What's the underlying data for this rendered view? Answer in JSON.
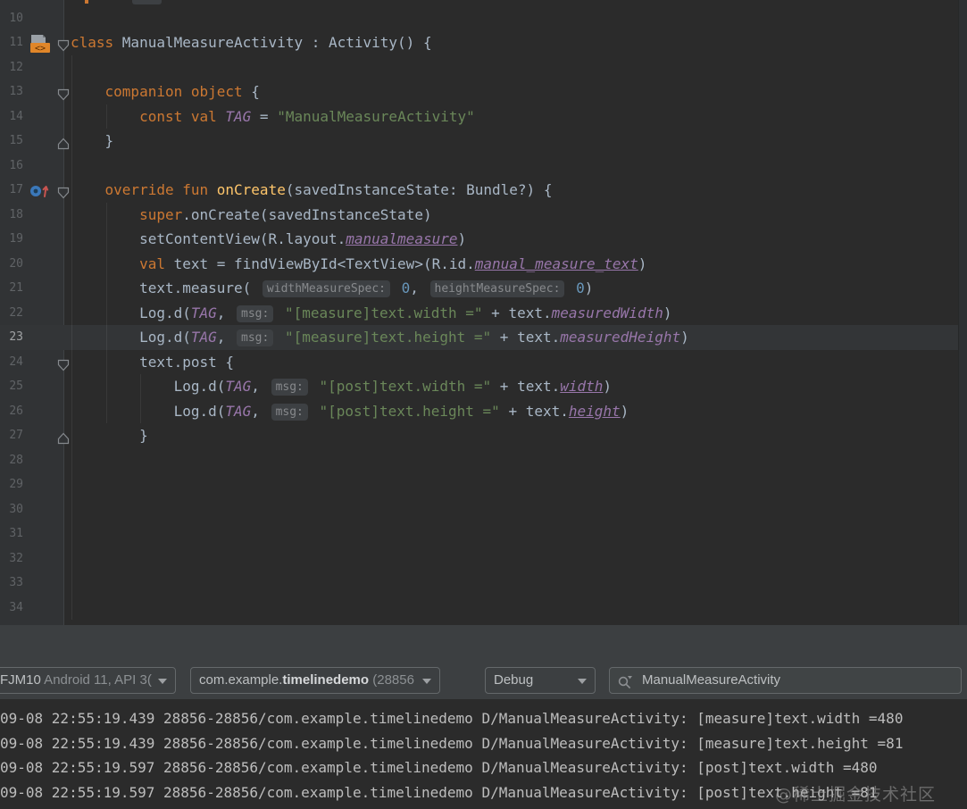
{
  "colors": {
    "editor_bg": "#2b2b2b",
    "gutter_bg": "#313335",
    "active_line_bg": "#333537",
    "keyword": "#cc7832",
    "string": "#6a8759",
    "number": "#6897bb",
    "property": "#9876aa",
    "function_decl": "#ffc66b",
    "default_text": "#a9b7c6",
    "line_number": "#606366",
    "hint_bg": "#3d4043",
    "hint_text": "#87898c",
    "toolbar_bg": "#3c3f41",
    "logcat_text": "#bdbdbd",
    "widget_border": "#64686a",
    "android_icon_orange": "#e08629",
    "override_icon_blue": "#3b78ba",
    "override_arrow_red": "#c75450"
  },
  "editor": {
    "active_line": 23,
    "first_line": 10,
    "indent_guides": [
      {
        "col": 0,
        "from": 12,
        "to": 34
      },
      {
        "col": 4,
        "from": 14,
        "to": 14
      },
      {
        "col": 4,
        "from": 18,
        "to": 26
      },
      {
        "col": 8,
        "from": 25,
        "to": 26
      }
    ],
    "lines": [
      {
        "n": 10,
        "segs": []
      },
      {
        "n": 11,
        "icon": "android-activity-icon",
        "fold": "down",
        "segs": [
          {
            "c": "k",
            "t": "class "
          },
          {
            "c": "d",
            "t": "ManualMeasureActivity : Activity() {"
          }
        ]
      },
      {
        "n": 12,
        "segs": []
      },
      {
        "n": 13,
        "fold": "down",
        "segs": [
          {
            "c": "d",
            "t": "    "
          },
          {
            "c": "k",
            "t": "companion object"
          },
          {
            "c": "d",
            "t": " {"
          }
        ]
      },
      {
        "n": 14,
        "segs": [
          {
            "c": "d",
            "t": "        "
          },
          {
            "c": "k",
            "t": "const val "
          },
          {
            "c": "p",
            "t": "TAG"
          },
          {
            "c": "d",
            "t": " = "
          },
          {
            "c": "s",
            "t": "\"ManualMeasureActivity\""
          }
        ]
      },
      {
        "n": 15,
        "fold": "up",
        "segs": [
          {
            "c": "d",
            "t": "    }"
          }
        ]
      },
      {
        "n": 16,
        "segs": []
      },
      {
        "n": 17,
        "icon": "override-method-icon",
        "fold": "down",
        "segs": [
          {
            "c": "d",
            "t": "    "
          },
          {
            "c": "k",
            "t": "override fun "
          },
          {
            "c": "f",
            "t": "onCreate"
          },
          {
            "c": "d",
            "t": "(savedInstanceState: Bundle?) {"
          }
        ]
      },
      {
        "n": 18,
        "segs": [
          {
            "c": "d",
            "t": "        "
          },
          {
            "c": "k",
            "t": "super"
          },
          {
            "c": "d",
            "t": ".onCreate(savedInstanceState)"
          }
        ]
      },
      {
        "n": 19,
        "segs": [
          {
            "c": "d",
            "t": "        setContentView(R.layout."
          },
          {
            "c": "pu",
            "t": "manualmeasure"
          },
          {
            "c": "d",
            "t": ")"
          }
        ]
      },
      {
        "n": 20,
        "segs": [
          {
            "c": "d",
            "t": "        "
          },
          {
            "c": "k",
            "t": "val "
          },
          {
            "c": "d",
            "t": "text = findViewById<TextView>(R.id."
          },
          {
            "c": "pu",
            "t": "manual_measure_text"
          },
          {
            "c": "d",
            "t": ")"
          }
        ]
      },
      {
        "n": 21,
        "segs": [
          {
            "c": "d",
            "t": "        text.measure( "
          },
          {
            "c": "h",
            "t": "widthMeasureSpec:"
          },
          {
            "c": "d",
            "t": " "
          },
          {
            "c": "n",
            "t": "0"
          },
          {
            "c": "d",
            "t": ", "
          },
          {
            "c": "h",
            "t": "heightMeasureSpec:"
          },
          {
            "c": "d",
            "t": " "
          },
          {
            "c": "n",
            "t": "0"
          },
          {
            "c": "d",
            "t": ")"
          }
        ]
      },
      {
        "n": 22,
        "segs": [
          {
            "c": "d",
            "t": "        Log.d("
          },
          {
            "c": "p",
            "t": "TAG"
          },
          {
            "c": "d",
            "t": ", "
          },
          {
            "c": "h",
            "t": "msg:"
          },
          {
            "c": "d",
            "t": " "
          },
          {
            "c": "s",
            "t": "\"[measure]text.width =\""
          },
          {
            "c": "d",
            "t": " + text."
          },
          {
            "c": "p",
            "t": "measuredWidth"
          },
          {
            "c": "d",
            "t": ")"
          }
        ]
      },
      {
        "n": 23,
        "segs": [
          {
            "c": "d",
            "t": "        Log.d("
          },
          {
            "c": "p",
            "t": "TAG"
          },
          {
            "c": "d",
            "t": ", "
          },
          {
            "c": "h",
            "t": "msg:"
          },
          {
            "c": "d",
            "t": " "
          },
          {
            "c": "s",
            "t": "\"[measure]text.height =\""
          },
          {
            "c": "d",
            "t": " + text."
          },
          {
            "c": "p",
            "t": "measuredHeight"
          },
          {
            "c": "d",
            "t": ")"
          }
        ]
      },
      {
        "n": 24,
        "fold": "down",
        "segs": [
          {
            "c": "d",
            "t": "        text.post {"
          }
        ]
      },
      {
        "n": 25,
        "segs": [
          {
            "c": "d",
            "t": "            Log.d("
          },
          {
            "c": "p",
            "t": "TAG"
          },
          {
            "c": "d",
            "t": ", "
          },
          {
            "c": "h",
            "t": "msg:"
          },
          {
            "c": "d",
            "t": " "
          },
          {
            "c": "s",
            "t": "\"[post]text.width =\""
          },
          {
            "c": "d",
            "t": " + text."
          },
          {
            "c": "pu",
            "t": "width"
          },
          {
            "c": "d",
            "t": ")"
          }
        ]
      },
      {
        "n": 26,
        "segs": [
          {
            "c": "d",
            "t": "            Log.d("
          },
          {
            "c": "p",
            "t": "TAG"
          },
          {
            "c": "d",
            "t": ", "
          },
          {
            "c": "h",
            "t": "msg:"
          },
          {
            "c": "d",
            "t": " "
          },
          {
            "c": "s",
            "t": "\"[post]text.height =\""
          },
          {
            "c": "d",
            "t": " + text."
          },
          {
            "c": "pu",
            "t": "height"
          },
          {
            "c": "d",
            "t": ")"
          }
        ]
      },
      {
        "n": 27,
        "fold": "up",
        "segs": [
          {
            "c": "d",
            "t": "        }"
          }
        ]
      },
      {
        "n": 28,
        "segs": []
      },
      {
        "n": 29,
        "segs": []
      },
      {
        "n": 30,
        "segs": []
      },
      {
        "n": 31,
        "segs": []
      },
      {
        "n": 32,
        "segs": []
      },
      {
        "n": 33,
        "segs": []
      },
      {
        "n": 34,
        "segs": []
      }
    ]
  },
  "toolbar": {
    "device_selector": {
      "name": "FJM10",
      "detail": " Android 11, API 3("
    },
    "process_selector": {
      "prefix": "com.example.",
      "app": "timelinedemo",
      "pid": " (28856"
    },
    "log_level_selector": {
      "value": "Debug"
    },
    "search": {
      "value": "ManualMeasureActivity"
    }
  },
  "logcat": {
    "lines": [
      "09-08 22:55:19.439 28856-28856/com.example.timelinedemo D/ManualMeasureActivity: [measure]text.width =480",
      "09-08 22:55:19.439 28856-28856/com.example.timelinedemo D/ManualMeasureActivity: [measure]text.height =81",
      "09-08 22:55:19.597 28856-28856/com.example.timelinedemo D/ManualMeasureActivity: [post]text.width =480",
      "09-08 22:55:19.597 28856-28856/com.example.timelinedemo D/ManualMeasureActivity: [post]text.height =81"
    ],
    "watermark": "@稀土掘金技术社区"
  }
}
